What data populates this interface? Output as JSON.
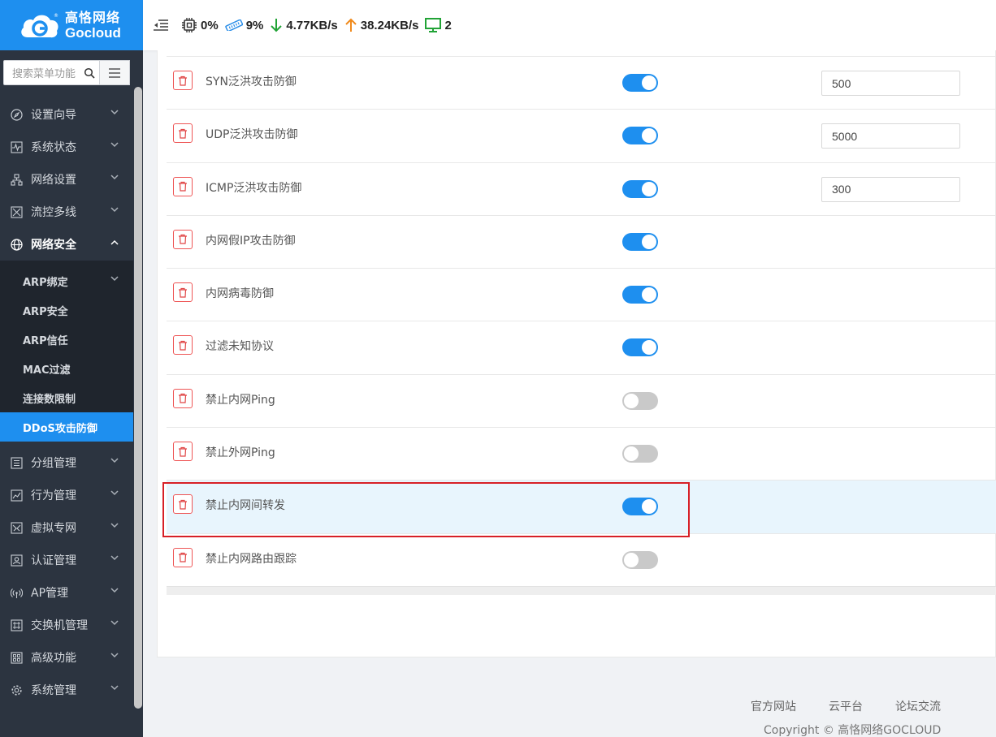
{
  "brand": {
    "name_cn": "高恪网络",
    "name_en": "Gocloud",
    "color": "#1e8fef"
  },
  "search": {
    "placeholder": "搜索菜单功能"
  },
  "topbar": {
    "cpu": "0%",
    "memory": "9%",
    "download": "4.77KB/s",
    "upload": "38.24KB/s",
    "devices": "2"
  },
  "nav": {
    "items_before": [
      {
        "label": "设置向导",
        "icon": "compass-icon"
      },
      {
        "label": "系统状态",
        "icon": "pulse-icon"
      },
      {
        "label": "网络设置",
        "icon": "network-icon"
      },
      {
        "label": "流控多线",
        "icon": "flow-icon"
      }
    ],
    "open_item": {
      "label": "网络安全",
      "icon": "globe-icon"
    },
    "sub_items": [
      {
        "label": "ARP绑定"
      },
      {
        "label": "ARP安全"
      },
      {
        "label": "ARP信任"
      },
      {
        "label": "MAC过滤"
      },
      {
        "label": "连接数限制"
      },
      {
        "label": "DDoS攻击防御"
      }
    ],
    "items_after": [
      {
        "label": "分组管理",
        "icon": "list-icon"
      },
      {
        "label": "行为管理",
        "icon": "chart-icon"
      },
      {
        "label": "虚拟专网",
        "icon": "vpn-icon"
      },
      {
        "label": "认证管理",
        "icon": "user-card-icon"
      },
      {
        "label": "AP管理",
        "icon": "antenna-icon"
      },
      {
        "label": "交换机管理",
        "icon": "switch-icon"
      },
      {
        "label": "高级功能",
        "icon": "grid-icon"
      },
      {
        "label": "系统管理",
        "icon": "gear-icon"
      }
    ]
  },
  "rules": [
    {
      "label": "SYN泛洪攻击防御",
      "enabled": true,
      "value": "500"
    },
    {
      "label": "UDP泛洪攻击防御",
      "enabled": true,
      "value": "5000"
    },
    {
      "label": "ICMP泛洪攻击防御",
      "enabled": true,
      "value": "300"
    },
    {
      "label": "内网假IP攻击防御",
      "enabled": true,
      "value": ""
    },
    {
      "label": "内网病毒防御",
      "enabled": true,
      "value": ""
    },
    {
      "label": "过滤未知协议",
      "enabled": true,
      "value": ""
    },
    {
      "label": "禁止内网Ping",
      "enabled": false,
      "value": ""
    },
    {
      "label": "禁止外网Ping",
      "enabled": false,
      "value": ""
    },
    {
      "label": "禁止内网间转发",
      "enabled": true,
      "value": "",
      "highlighted": true
    },
    {
      "label": "禁止内网路由跟踪",
      "enabled": false,
      "value": ""
    }
  ],
  "footer": {
    "links": [
      "官方网站",
      "云平台",
      "论坛交流"
    ],
    "copyright": "Copyright © 高恪网络GOCLOUD"
  }
}
